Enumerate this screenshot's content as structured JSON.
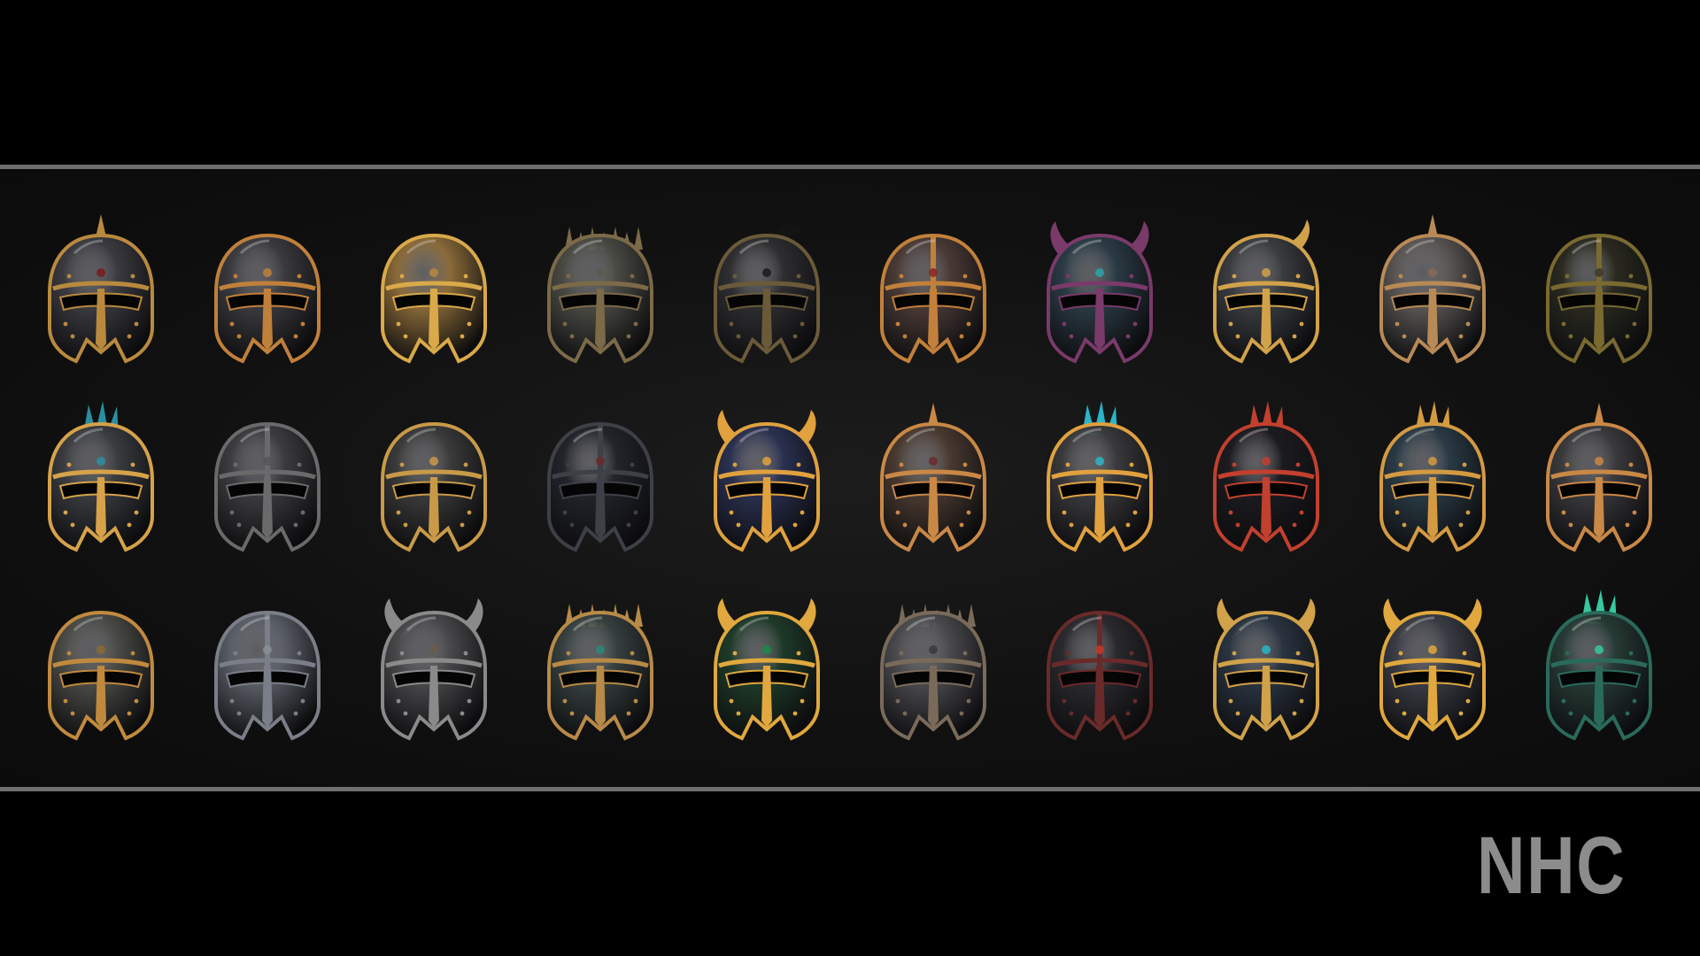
{
  "brand": {
    "logo_text": "NHC"
  },
  "helmets": [
    {
      "icon": "spired-sallet-helmet-icon",
      "metal": "#3a3a40",
      "trim": "#b98a3e",
      "accent": "#7a1c1c",
      "crest": "spike"
    },
    {
      "icon": "barred-close-helmet-icon",
      "metal": "#3b3b3f",
      "trim": "#c0803a",
      "accent": "#c0803a",
      "crest": "none"
    },
    {
      "icon": "gold-sallet-helmet-icon",
      "metal": "#8a6a38",
      "trim": "#d9a94a",
      "accent": "#b98a3e",
      "crest": "none"
    },
    {
      "icon": "thorned-great-helm-icon",
      "metal": "#4a4a44",
      "trim": "#7c6a48",
      "accent": "#5a5a52",
      "crest": "thorns"
    },
    {
      "icon": "plumed-dark-helm-icon",
      "metal": "#2e2e30",
      "trim": "#6b5a3a",
      "accent": "#1a1a1a",
      "crest": "plume"
    },
    {
      "icon": "crimson-barbute-helmet-icon",
      "metal": "#4a3a36",
      "trim": "#c2803a",
      "accent": "#8c2222",
      "crest": "ridge"
    },
    {
      "icon": "horned-teal-helmet-icon",
      "metal": "#2a3a44",
      "trim": "#7a3a6a",
      "accent": "#2aa6a6",
      "crest": "horns"
    },
    {
      "icon": "winged-gold-helmet-icon",
      "metal": "#3a3c40",
      "trim": "#d1a24a",
      "accent": "#d1a24a",
      "crest": "horn-one"
    },
    {
      "icon": "riveted-nasal-helmet-icon",
      "metal": "#5a5654",
      "trim": "#b88a56",
      "accent": "#8a6a58",
      "crest": "spike"
    },
    {
      "icon": "shadow-olive-helmet-icon",
      "metal": "#2a2a20",
      "trim": "#7a6a30",
      "accent": "#3a3a28",
      "crest": "ridge"
    },
    {
      "icon": "crested-gold-trim-helmet-icon",
      "metal": "#3a3c40",
      "trim": "#d6a24a",
      "accent": "#2a8fa0",
      "crest": "fan"
    },
    {
      "icon": "steel-visor-helmet-icon",
      "metal": "#3c3c40",
      "trim": "#6a6a6a",
      "accent": "#555555",
      "crest": "ridge"
    },
    {
      "icon": "gilded-bascinet-helmet-icon",
      "metal": "#3a3a3a",
      "trim": "#c89a48",
      "accent": "#c89a48",
      "crest": "none"
    },
    {
      "icon": "obsidian-helm-icon",
      "metal": "#22242a",
      "trim": "#3e4048",
      "accent": "#6a2a2a",
      "crest": "ridge"
    },
    {
      "icon": "royal-horned-helmet-icon",
      "metal": "#2a3050",
      "trim": "#e0a13e",
      "accent": "#e0a13e",
      "crest": "horns"
    },
    {
      "icon": "bronze-mask-helmet-icon",
      "metal": "#4a3a30",
      "trim": "#c98846",
      "accent": "#6a2a30",
      "crest": "spike"
    },
    {
      "icon": "sunburst-crest-helmet-icon",
      "metal": "#3a3a3c",
      "trim": "#e0a13e",
      "accent": "#2ab6c8",
      "crest": "fan"
    },
    {
      "icon": "flame-crest-helmet-icon",
      "metal": "#1c1c20",
      "trim": "#c2402e",
      "accent": "#c2402e",
      "crest": "fan"
    },
    {
      "icon": "mohawk-gold-helmet-icon",
      "metal": "#2a3a44",
      "trim": "#d49a42",
      "accent": "#d49a42",
      "crest": "fan"
    },
    {
      "icon": "cross-face-helmet-icon",
      "metal": "#3a3a3c",
      "trim": "#c98846",
      "accent": "#c98846",
      "crest": "spike"
    },
    {
      "icon": "weathered-bucket-helmet-icon",
      "metal": "#4a4a46",
      "trim": "#c08a3e",
      "accent": "#8a6a30",
      "crest": "none"
    },
    {
      "icon": "silver-knight-helmet-icon",
      "metal": "#5a5e66",
      "trim": "#7a7e88",
      "accent": "#8a8e98",
      "crest": "ridge"
    },
    {
      "icon": "engraved-horned-helmet-icon",
      "metal": "#48484a",
      "trim": "#8a8a8a",
      "accent": "#6a5a4a",
      "crest": "horns"
    },
    {
      "icon": "verdant-spiked-helmet-icon",
      "metal": "#36403e",
      "trim": "#b88a48",
      "accent": "#2a8a7a",
      "crest": "thorns"
    },
    {
      "icon": "emerald-crown-helmet-icon",
      "metal": "#1e3a28",
      "trim": "#e0a83e",
      "accent": "#1a8a4a",
      "crest": "horns"
    },
    {
      "icon": "sawtooth-crest-helmet-icon",
      "metal": "#4a4a4c",
      "trim": "#7a6a5a",
      "accent": "#3a3a3a",
      "crest": "thorns"
    },
    {
      "icon": "ember-dark-helmet-icon",
      "metal": "#2a2a2e",
      "trim": "#6a2a2a",
      "accent": "#c23a2a",
      "crest": "ridge"
    },
    {
      "icon": "azure-fin-helmet-icon",
      "metal": "#2a3440",
      "trim": "#d1a24a",
      "accent": "#2ab6c8",
      "crest": "horns"
    },
    {
      "icon": "golden-thorn-helmet-icon",
      "metal": "#3a3c44",
      "trim": "#e0a83e",
      "accent": "#e0a83e",
      "crest": "horns"
    },
    {
      "icon": "jade-rune-helmet-icon",
      "metal": "#263a34",
      "trim": "#2a6a5a",
      "accent": "#38c8a0",
      "crest": "fan"
    }
  ]
}
